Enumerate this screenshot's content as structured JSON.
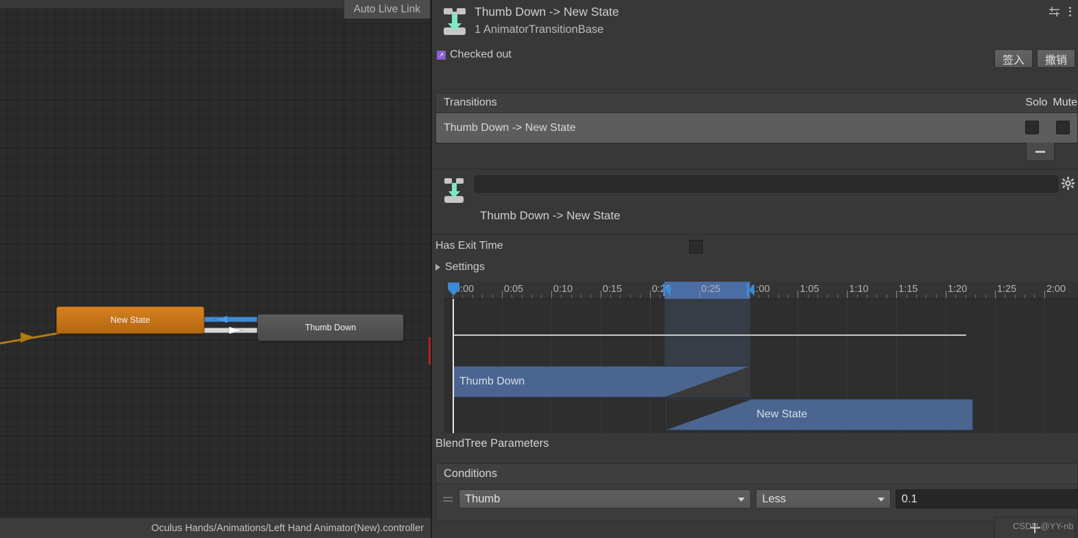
{
  "graph_panel": {
    "tab_label": "Auto Live Link",
    "footer_path": "Oculus Hands/Animations/Left Hand Animator(New).controller",
    "nodes": [
      {
        "name": "New State",
        "type": "default-state",
        "color": "#c5741a"
      },
      {
        "name": "Thumb Down",
        "type": "state",
        "color": "#535353"
      }
    ],
    "edges": [
      {
        "name": "thumbdown-to-newstate",
        "color": "#3d8bd4"
      },
      {
        "name": "newstate-to-thumbdown",
        "color": "#e8e8e8"
      },
      {
        "name": "entry-edge",
        "color": "#b07b10"
      }
    ],
    "exit_marker_color": "#b22222"
  },
  "inspector": {
    "header": {
      "title": "Thumb Down -> New State",
      "subtitle": "1 AnimatorTransitionBase",
      "icon": "animator-transition-icon",
      "preset_icon": "preset-sliders-icon",
      "menu_icon": "kebab-menu-icon"
    },
    "vcs": {
      "status_label": "Checked out",
      "badge_glyph": "↗",
      "badge_color": "#8a5fd0",
      "checkin_label": "签入",
      "revert_label": "撒销"
    },
    "transitions": {
      "section_label": "Transitions",
      "col_solo": "Solo",
      "col_mute": "Mute",
      "rows": [
        {
          "label": "Thumb Down -> New State",
          "solo": false,
          "mute": false
        }
      ],
      "remove_button_label": "−"
    },
    "transition_detail": {
      "name_value": "",
      "name_placeholder": "",
      "title": "Thumb Down -> New State",
      "gear_icon": "gear-icon",
      "asset_icon": "animator-transition-icon",
      "has_exit_time_label": "Has Exit Time",
      "has_exit_time_checked": false,
      "settings_label": "Settings",
      "settings_expanded": false
    },
    "timeline": {
      "ruler_ticks": [
        {
          "label": "0:00",
          "t": 0.0
        },
        {
          "label": "0:05",
          "t": 5.0
        },
        {
          "label": "0:10",
          "t": 10.0
        },
        {
          "label": "0:15",
          "t": 15.0
        },
        {
          "label": "0:20",
          "t": 20.0
        },
        {
          "label": "0:25",
          "t": 25.0
        },
        {
          "label": "1:00",
          "t": 30.0
        },
        {
          "label": "1:05",
          "t": 35.0
        },
        {
          "label": "1:10",
          "t": 40.0
        },
        {
          "label": "1:15",
          "t": 45.0
        },
        {
          "label": "1:20",
          "t": 50.0
        },
        {
          "label": "1:25",
          "t": 55.0
        },
        {
          "label": "2:00",
          "t": 60.0
        }
      ],
      "selection": {
        "start_t": 21.5,
        "end_t": 30.2
      },
      "playhead_t": 0.0,
      "clips": [
        {
          "label": "Thumb Down",
          "start_t": 0.0,
          "end_t": 30.2,
          "fade_out_start_t": 21.6,
          "row": 0
        },
        {
          "label": "New State",
          "start_t": 21.6,
          "end_t": 52.8,
          "fade_in_end_t": 30.2,
          "row": 1
        }
      ],
      "clip_color": "#4a6590",
      "selection_color": "#4a6da5"
    },
    "blendtree_label": "BlendTree Parameters",
    "conditions": {
      "section_label": "Conditions",
      "rows": [
        {
          "parameter": "Thumb",
          "operator": "Less",
          "value": "0.1"
        }
      ]
    },
    "add_condition_label": "+",
    "watermark": "CSDN @YY-nb"
  }
}
